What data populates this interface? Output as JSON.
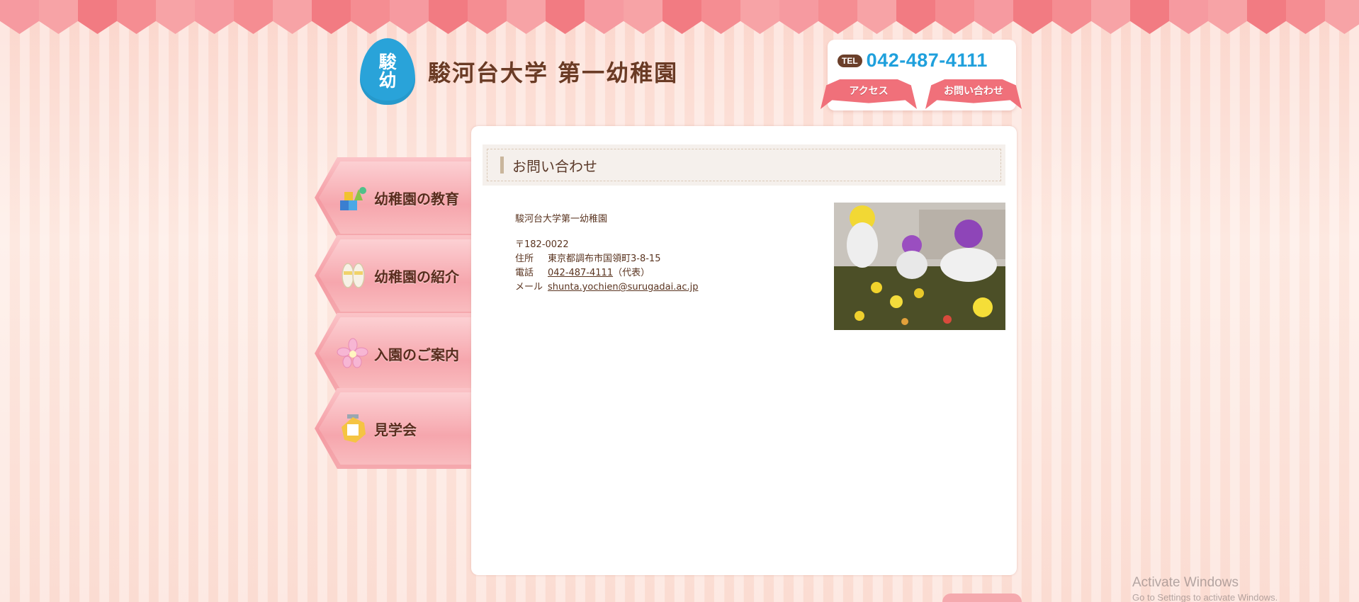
{
  "header": {
    "logo_mark_line1": "駿",
    "logo_mark_line2": "幼",
    "title": "駿河台大学 第一幼稚園"
  },
  "contact": {
    "tel_badge": "TEL",
    "tel_number": "042-487-4111",
    "access_label": "アクセス",
    "inquiry_label": "お問い合わせ"
  },
  "side_nav": [
    {
      "label": "幼稚園の教育",
      "icon": "blocks-icon"
    },
    {
      "label": "幼稚園の紹介",
      "icon": "shoes-icon"
    },
    {
      "label": "入園のご案内",
      "icon": "flower-icon"
    },
    {
      "label": "見学会",
      "icon": "name-badge-icon"
    }
  ],
  "main": {
    "heading": "お問い合わせ",
    "org_name": "駿河台大学第一幼稚園",
    "postal": "〒182-0022",
    "address_label": "住所",
    "address": "東京都調布市国領町3-8-15",
    "phone_label": "電話",
    "phone": "042-487-4111",
    "phone_suffix": "（代表）",
    "mail_label": "メール",
    "mail": "shunta.yochien@surugadai.ac.jp"
  },
  "os_overlay": {
    "line1": "Activate Windows",
    "line2": "Go to Settings to activate Windows."
  },
  "colors": {
    "brand_blue": "#29a3d9",
    "brown_text": "#5a3420",
    "pink_ribbon": "#f0707a",
    "pink_nav": "#f49aa2"
  }
}
